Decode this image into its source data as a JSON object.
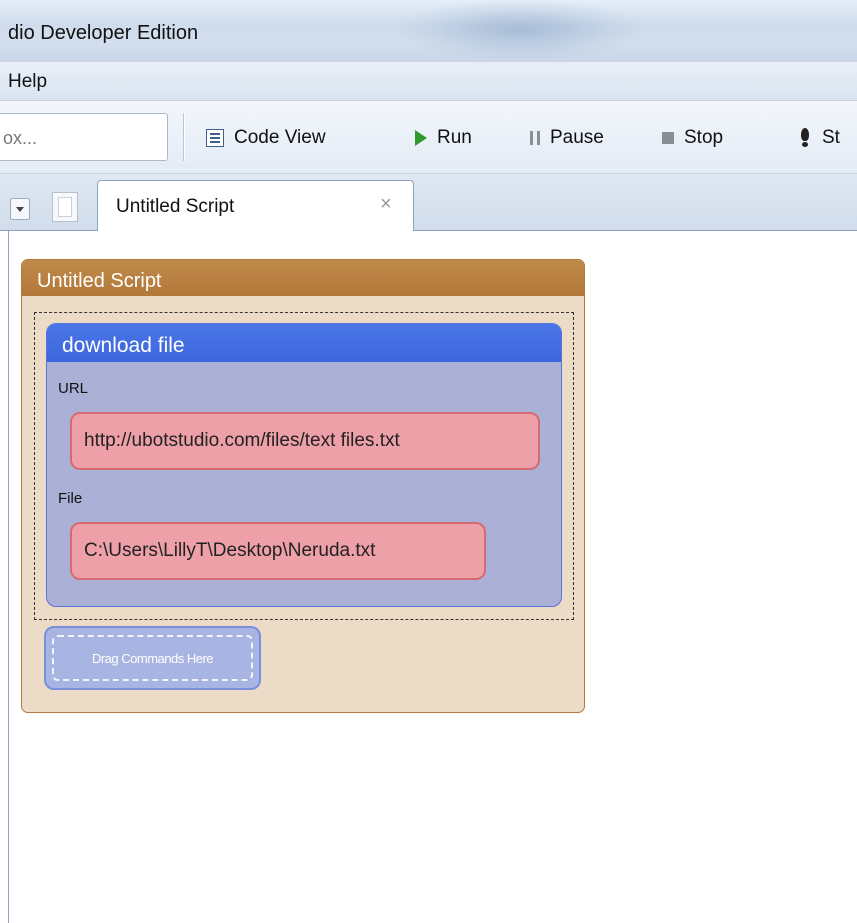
{
  "window": {
    "title": "dio Developer Edition"
  },
  "menu": {
    "help": "Help"
  },
  "toolbar": {
    "search_placeholder": "ox...",
    "code_view": "Code View",
    "run": "Run",
    "pause": "Pause",
    "stop": "Stop",
    "step": "St"
  },
  "tabs": {
    "active": "Untitled Script",
    "close": "×"
  },
  "script": {
    "title": "Untitled Script",
    "command": {
      "name": "download file",
      "params": [
        {
          "label": "URL",
          "value": "http://ubotstudio.com/files/text files.txt"
        },
        {
          "label": "File",
          "value": "C:\\Users\\LillyT\\Desktop\\Neruda.txt"
        }
      ]
    },
    "drop_target": "Drag Commands Here"
  }
}
